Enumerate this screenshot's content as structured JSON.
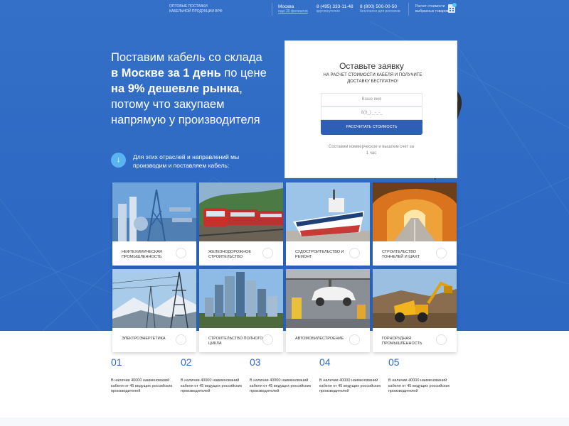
{
  "topbar": {
    "brand_line1": "ОПТОВЫЕ ПОСТАВКИ",
    "brand_line2": "КАБЕЛЬНОЙ ПРОДУКЦИИ ВРФ",
    "city": "Москва",
    "city_link": "еще 30 филиалов",
    "phone1": "8 (495) 333-11-48",
    "phone1_caption": "круглосуточно",
    "phone2": "8 (800) 500-00-50",
    "phone2_caption": "бесплатно для регионов",
    "calc_line1": "Расчет стоимости",
    "calc_line2": "выбранных товаров"
  },
  "hero": {
    "line1": "Поставим кабель со склада",
    "line2_bold": "в Москве за 1 день",
    "line2_rest": " по цене",
    "line3_bold": "на 9% дешевле рынка",
    "line3_rest": ",",
    "line4": "потому что закупаем",
    "line5": "напрямую у производителя",
    "industries_note": "Для этих отраслей и направлений мы производим и поставляем кабель:"
  },
  "form": {
    "title": "Оставьте заявку",
    "subtitle": "НА РАСЧЕТ СТОИМОСТИ КАБЕЛЯ И ПОЛУЧИТЕ ДОСТАВКУ БЕСПЛАТНО!",
    "name_placeholder": "Ваше имя",
    "phone_placeholder": "8(9_) _-_-_",
    "submit_label": "РАССЧИТАТЬ СТОИМОСТЬ",
    "note": "Составим коммерческое и вышлем счет за 1 час"
  },
  "industries": [
    {
      "label": "НЕФТЕХИМИЧЕСКАЯ ПРОМЫШЛЕННОСТЬ",
      "icon": "oil-refinery"
    },
    {
      "label": "ЖЕЛЕЗНОДОРОЖНОЕ СТРОИТЕЛЬСТВО",
      "icon": "train"
    },
    {
      "label": "СУДОСТРОИТЕЛЬСТВО И РЕМОНТ",
      "icon": "ship"
    },
    {
      "label": "СТРОИТЕЛЬСТВО ТОННЕЛЕЙ И ШАХТ",
      "icon": "tunnel"
    },
    {
      "label": "ЭЛЕКТРОЭНЕРГЕТИКА",
      "icon": "power-tower"
    },
    {
      "label": "СТРОИТЕЛЬСТВО ПОЛНОГО ЦИКЛА",
      "icon": "skyscrapers"
    },
    {
      "label": "АВТОМОБИЛЕСТРОЕНИЕ",
      "icon": "car-factory"
    },
    {
      "label": "ГОРНОРУДНАЯ ПРОМЫШЛЕННОСТЬ",
      "icon": "mining-truck"
    }
  ],
  "stats": [
    {
      "num": "01",
      "text": "В наличии 40000 наименований кабеля от 45 ведущих российских производителей"
    },
    {
      "num": "02",
      "text": "В наличии 40000 наименований кабеля от 45 ведущих российских производителей"
    },
    {
      "num": "03",
      "text": "В наличии 40000 наименований кабеля от 45 ведущих российских производителей"
    },
    {
      "num": "04",
      "text": "В наличии 40000 наименований кабеля от 45 ведущих российских производителей"
    },
    {
      "num": "05",
      "text": "В наличии 40000 наименований кабеля от 45 ведущих российских производителей"
    }
  ],
  "colors": {
    "hero_blue": "#3470c7",
    "button_blue": "#2f5fb4",
    "accent_cyan": "#5ab4f3"
  }
}
